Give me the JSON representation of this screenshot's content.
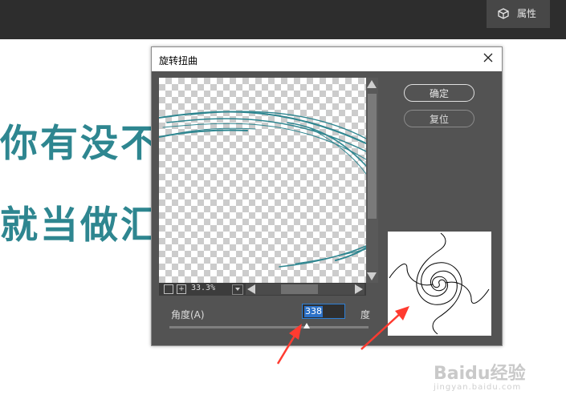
{
  "topbar": {
    "properties_label": "属性"
  },
  "background_text": {
    "line1": "你有没不",
    "line2": "就当做汇"
  },
  "dialog": {
    "title": "旋转扭曲",
    "buttons": {
      "ok": "确定",
      "reset": "复位"
    },
    "zoom": {
      "minus": "−",
      "plus": "+",
      "value": "33.3%"
    },
    "angle": {
      "label": "角度(A)",
      "value": "338",
      "unit": "度"
    },
    "slider_level_fraction": 0.69
  },
  "watermark": {
    "brand": "Baidu经验",
    "url": "jingyan.baidu.com"
  },
  "colors": {
    "accent_text": "#2e8690",
    "dialog_bg": "#535353",
    "annotation_arrow": "#ff3b30"
  }
}
